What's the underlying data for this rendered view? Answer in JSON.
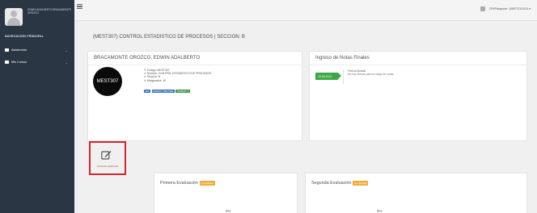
{
  "sidebar": {
    "user_name": "EDWIN ADALBERTO BRACAMONTE OROZCO",
    "nav_header": "NAVEGACIÓN PRINCIPAL",
    "items": [
      {
        "label": "Asistencias",
        "icon": "folder-icon"
      },
      {
        "label": "Mis Cursos",
        "icon": "folder-icon"
      }
    ]
  },
  "topbar": {
    "user_label": "DPI/Pasaporte: 1689770119101 ▾"
  },
  "page": {
    "title": "(MEST307) CONTROL ESTADISTICO DE PROCESOS | SECCION: B"
  },
  "course_card": {
    "teacher": "BRACAMONTE OROZCO, EDWIN ADALBERTO",
    "avatar_text": "MEST307",
    "details": [
      "✎ Código: MEST307",
      "✔ Nombre: CONTROL ESTADISTICO DE PROCESOS",
      "✔ Sección: B",
      "✔ #Asignados: 15"
    ],
    "badges": [
      {
        "text": "INIT",
        "color": "#3b74c4"
      },
      {
        "text": "MONDAY TIME TIME",
        "color": "#3b74c4"
      },
      {
        "text": "TUESDAY T.",
        "color": "#3c9a4a"
      }
    ]
  },
  "grades_card": {
    "title": "Ingreso de Notas Finales",
    "date_badge": "15-06-2021",
    "fecha_title": "Fecha Actual",
    "fecha_sub": "No hay fechas para la carga de notas."
  },
  "tool": {
    "label": "Controlar asistencia",
    "icon": "edit-icon"
  },
  "evaluations": [
    {
      "title": "Primera Evaluación",
      "status": "no evaluado",
      "percent": "0%"
    },
    {
      "title": "Segunda Evaluación",
      "status": "no evaluado",
      "percent": "0%"
    }
  ],
  "colors": {
    "sidebar_bg": "#2b3644",
    "accent_green": "#3ca843",
    "highlight_red": "#d6242f",
    "status_orange": "#f0ad3a"
  }
}
